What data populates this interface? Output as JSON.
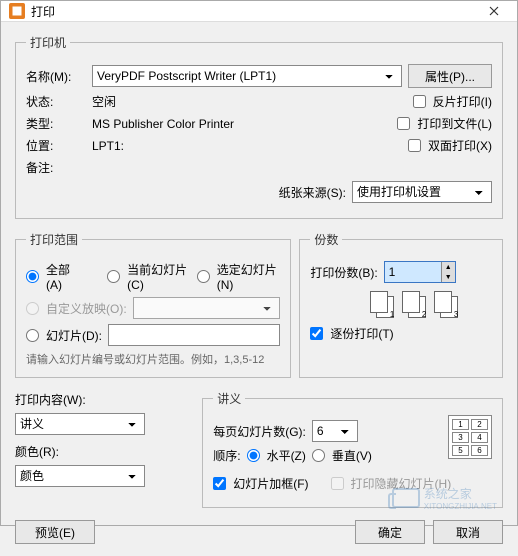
{
  "window": {
    "title": "打印"
  },
  "printer": {
    "legend": "打印机",
    "name_label": "名称(M):",
    "name_value": "VeryPDF Postscript Writer (LPT1)",
    "properties_btn": "属性(P)...",
    "status_label": "状态:",
    "status_value": "空闲",
    "type_label": "类型:",
    "type_value": "MS Publisher Color Printer",
    "where_label": "位置:",
    "where_value": "LPT1:",
    "comment_label": "备注:",
    "reverse_ck": "反片打印(I)",
    "tofile_ck": "打印到文件(L)",
    "duplex_ck": "双面打印(X)",
    "paper_source_label": "纸张来源(S):",
    "paper_source_value": "使用打印机设置"
  },
  "range": {
    "legend": "打印范围",
    "all": "全部(A)",
    "current": "当前幻灯片(C)",
    "selection": "选定幻灯片(N)",
    "custom": "自定义放映(O):",
    "slides": "幻灯片(D):",
    "hint": "请输入幻灯片编号或幻灯片范围。例如，1,3,5-12"
  },
  "copies": {
    "legend": "份数",
    "count_label": "打印份数(B):",
    "count_value": "1",
    "collate": "逐份打印(T)"
  },
  "what": {
    "label": "打印内容(W):",
    "value": "讲义",
    "color_label": "颜色(R):",
    "color_value": "颜色"
  },
  "handout": {
    "legend": "讲义",
    "per_page_label": "每页幻灯片数(G):",
    "per_page_value": "6",
    "order_label": "顺序:",
    "horizontal": "水平(Z)",
    "vertical": "垂直(V)",
    "frame_ck": "幻灯片加框(F)",
    "hidden_ck": "打印隐藏幻灯片(H)"
  },
  "buttons": {
    "preview": "预览(E)",
    "ok": "确定",
    "cancel": "取消"
  },
  "watermark": {
    "text": "系统之家",
    "url": "XITONGZHIJIA.NET"
  }
}
